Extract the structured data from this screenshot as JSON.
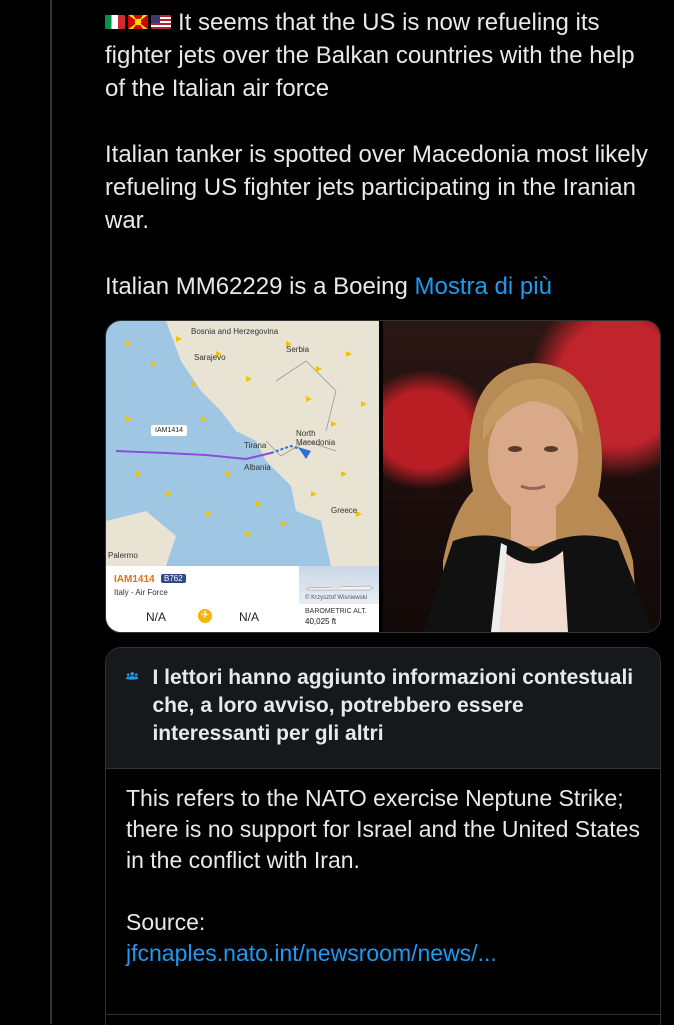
{
  "tweet": {
    "flags": [
      "flag-italy-icon",
      "flag-north-macedonia-icon",
      "flag-usa-icon"
    ],
    "paragraphs": [
      "It seems that the US is now refueling its fighter jets over the Balkan countries with the help of the Italian air force",
      "Italian tanker is spotted over Macedonia most likely refueling US fighter jets participating in the Iranian war.",
      "Italian MM62229 is a Boeing"
    ],
    "show_more": "Mostra di più"
  },
  "map": {
    "labels": [
      "Bosnia and Herzegovina",
      "Sarajevo",
      "Serbia",
      "North Macedonia",
      "Tirana",
      "Albania",
      "Greece",
      "Palermo"
    ],
    "flight_tag": "IAM1414",
    "callsign": "IAM1414",
    "aircraft_type": "B762",
    "airline": "Italy - Air Force",
    "origin": "N/A",
    "destination": "N/A",
    "photo_credit": "© Krzysztof Wisniewski",
    "baro_label": "BAROMETRIC ALT.",
    "altitude": "40,025 ft"
  },
  "note": {
    "header": "I lettori hanno aggiunto informazioni contestuali che, a loro avviso, potrebbero essere interessanti per gli altri",
    "body": "This refers to the NATO exercise Neptune Strike; there is no support for Israel and the United States in the conflict with Iran.",
    "source_label": "Source:",
    "source_link": "jfcnaples.nato.int/newsroom/news/..."
  },
  "colors": {
    "background": "#000000",
    "text": "#e7e9ea",
    "link": "#1d9bf0",
    "note_header_bg": "#16181c",
    "border": "#2f3336"
  }
}
